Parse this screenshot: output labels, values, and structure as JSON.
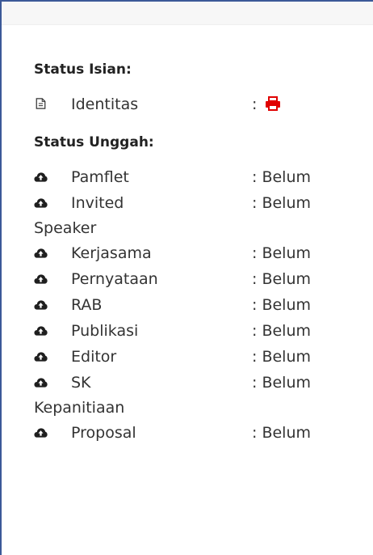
{
  "status_isian": {
    "heading": "Status Isian:",
    "items": [
      {
        "label": "Identitas",
        "separator": ":",
        "icon": "file-icon",
        "status_icon": "print-icon",
        "status_color": "#e00000"
      }
    ]
  },
  "status_unggah": {
    "heading": "Status Unggah:",
    "items": [
      {
        "label": "Pamflet",
        "status": ": Belum",
        "icon": "cloud-upload-icon"
      },
      {
        "label": "Invited",
        "continuation": "Speaker",
        "status": ": Belum",
        "icon": "cloud-upload-icon"
      },
      {
        "label": "Kerjasama",
        "status": ": Belum",
        "icon": "cloud-upload-icon"
      },
      {
        "label": "Pernyataan",
        "status": ": Belum",
        "icon": "cloud-upload-icon"
      },
      {
        "label": "RAB",
        "status": ": Belum",
        "icon": "cloud-upload-icon"
      },
      {
        "label": "Publikasi",
        "status": ": Belum",
        "icon": "cloud-upload-icon"
      },
      {
        "label": "Editor",
        "status": ": Belum",
        "icon": "cloud-upload-icon"
      },
      {
        "label": "SK",
        "continuation": "Kepanitiaan",
        "status": ": Belum",
        "icon": "cloud-upload-icon"
      },
      {
        "label": "Proposal",
        "status": ": Belum",
        "icon": "cloud-upload-icon"
      }
    ]
  },
  "colors": {
    "frame_border": "#3b5998",
    "text": "#333333",
    "heading": "#222222",
    "print_icon": "#e00000"
  }
}
